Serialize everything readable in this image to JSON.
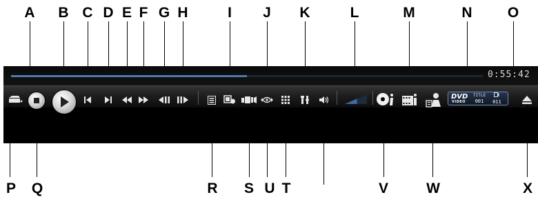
{
  "player": {
    "elapsed_time": "0:55:42",
    "seek_progress": 0.5,
    "volume_level": 0.55
  },
  "dvd_panel": {
    "logo_text": "DVD",
    "logo_subtext": "VIDEO",
    "title_label": "TITLE",
    "title_value": "001",
    "chapter_value": "011"
  },
  "callouts": {
    "A": "A",
    "B": "B",
    "C": "C",
    "D": "D",
    "E": "E",
    "F": "F",
    "G": "G",
    "H": "H",
    "I": "I",
    "J": "J",
    "K": "K",
    "L": "L",
    "M": "M",
    "N": "N",
    "O": "O",
    "P": "P",
    "Q": "Q",
    "R": "R",
    "S": "S",
    "U": "U",
    "T": "T",
    "V": "V",
    "W": "W",
    "X": "X"
  },
  "icons": {
    "A": "seek-bar",
    "B": "play-icon",
    "C": "previous-icon",
    "D": "next-icon",
    "E": "rewind-icon",
    "F": "fast-forward-icon",
    "G": "step-back-icon",
    "H": "step-forward-icon",
    "I": "capture-icon",
    "J": "viewpoint-icon",
    "K": "settings-icon",
    "L": "volume-slider",
    "M": "film-info-icon",
    "N": "dvd-status-panel",
    "O": "time-display",
    "P": "mode-icon",
    "Q": "stop-icon",
    "R": "menu-icon",
    "S": "angle-icon",
    "T": "numeric-pad-icon",
    "U": "subtitle-icon",
    "V": "info-icon",
    "W": "help-icon",
    "X": "eject-icon"
  },
  "colors": {
    "bar_background": "#000000",
    "seek_fill": "#5277a8",
    "icon_color": "#e8e8e8",
    "panel_border": "#6e8fb8"
  }
}
